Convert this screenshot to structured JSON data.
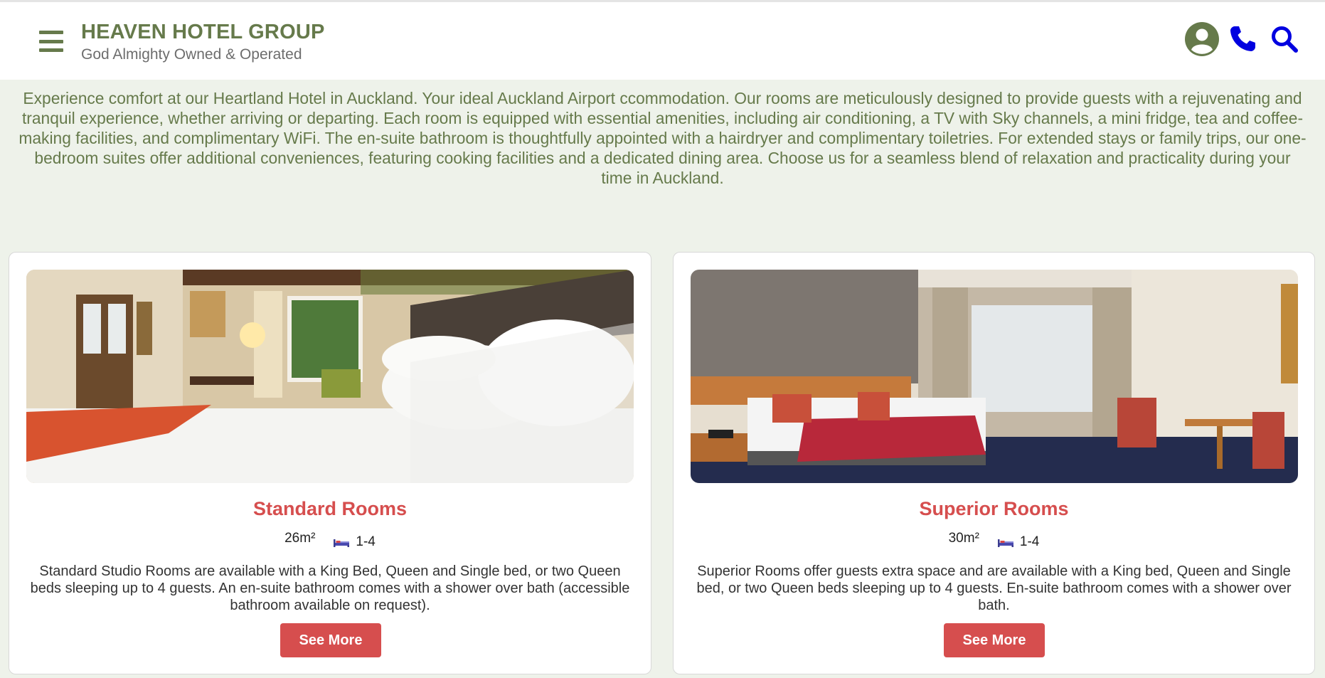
{
  "header": {
    "brand_name": "HEAVEN HOTEL GROUP",
    "tagline": "God Almighty Owned & Operated",
    "icons": [
      "menu-icon",
      "user-icon",
      "phone-icon",
      "search-icon"
    ]
  },
  "intro": {
    "text": "Experience comfort at our Heartland Hotel in Auckland. Your ideal Auckland Airport ccommodation. Our rooms are meticulously designed to provide guests with a rejuvenating and tranquil experience, whether arriving or departing. Each room is equipped with essential amenities, including air conditioning, a TV with Sky channels, a mini fridge, tea and coffee-making facilities, and complimentary WiFi. The en-suite bathroom is thoughtfully appointed with a hairdryer and complimentary toiletries. For extended stays or family trips, our one-bedroom suites offer additional conveniences, featuring cooking facilities and a dedicated dining area. Choose us for a seamless blend of relaxation and practicality during your time in Auckland."
  },
  "rooms": [
    {
      "title": "Standard Rooms",
      "size": "26m²",
      "guests": "1-4",
      "description": "Standard Studio Rooms are available with a King Bed, Queen and Single bed, or two Queen beds sleeping up to 4 guests. An en-suite bathroom comes with a shower over bath (accessible bathroom available on request).",
      "button_label": "See More"
    },
    {
      "title": "Superior Rooms",
      "size": "30m²",
      "guests": "1-4",
      "description": "Superior Rooms offer guests extra space and are available with a King bed, Queen and Single bed, or two Queen beds sleeping up to 4 guests. En-suite bathroom comes with a shower over bath.",
      "button_label": "See More"
    }
  ],
  "colors": {
    "brand_green": "#667a4b",
    "accent_red": "#d64e4e",
    "icon_blue": "#0000e0",
    "page_bg": "#eef2ea"
  }
}
